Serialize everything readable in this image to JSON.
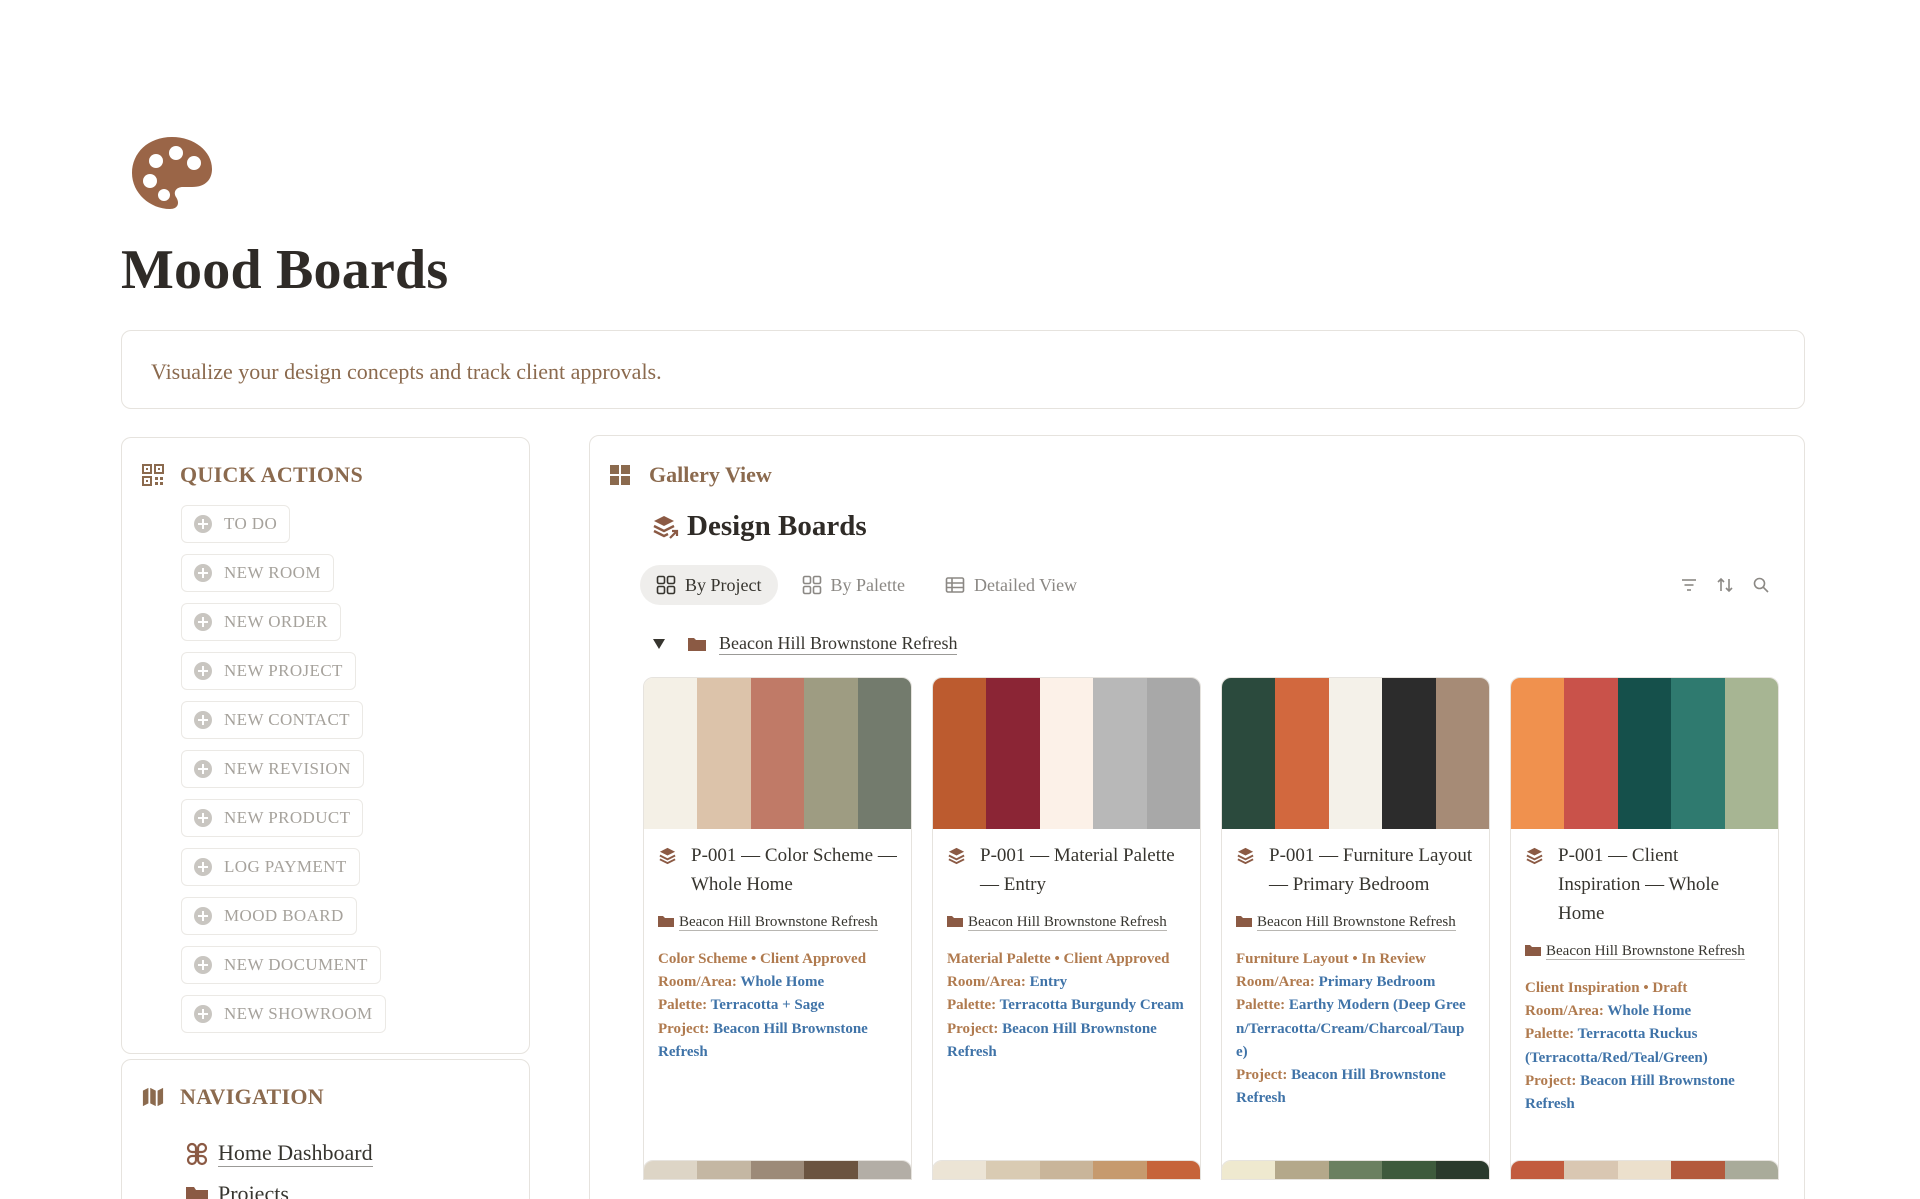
{
  "page": {
    "title": "Mood Boards",
    "icon": "palette-icon",
    "description": "Visualize your design concepts and track client approvals."
  },
  "quick_actions": {
    "title": "QUICK ACTIONS",
    "icon": "qr-grid-icon",
    "items": [
      {
        "label": "TO DO"
      },
      {
        "label": "NEW ROOM"
      },
      {
        "label": "NEW ORDER"
      },
      {
        "label": "NEW PROJECT"
      },
      {
        "label": "NEW CONTACT"
      },
      {
        "label": "NEW REVISION"
      },
      {
        "label": "NEW PRODUCT"
      },
      {
        "label": "LOG PAYMENT"
      },
      {
        "label": "MOOD BOARD"
      },
      {
        "label": "NEW DOCUMENT"
      },
      {
        "label": "NEW SHOWROOM"
      }
    ]
  },
  "navigation": {
    "title": "NAVIGATION",
    "icon": "map-icon",
    "items": [
      {
        "label": "Home Dashboard",
        "icon": "command-icon"
      },
      {
        "label": "Projects",
        "icon": "folder-icon"
      }
    ]
  },
  "gallery": {
    "header": "Gallery View",
    "icon": "grid-icon",
    "database_title": "Design Boards",
    "database_icon": "stack-icon",
    "tabs": [
      {
        "label": "By Project",
        "active": true
      },
      {
        "label": "By Palette",
        "active": false
      },
      {
        "label": "Detailed View",
        "active": false
      }
    ],
    "tools": [
      "filter-icon",
      "sort-icon",
      "search-icon"
    ],
    "group_label": "Beacon Hill Brownstone Refresh",
    "field_labels": {
      "room": "Room/Area:",
      "palette": "Palette:",
      "project": "Project:"
    },
    "cards": [
      {
        "title": "P-001 — Color Scheme — Whole Home",
        "project_tag": "Beacon Hill Brownstone Refresh",
        "type_status": "Color Scheme • Client Approved",
        "room": "Whole Home",
        "palette": "Terracotta + Sage",
        "project": "Beacon Hill Brownstone Refresh",
        "colors": [
          "#f4f0e6",
          "#dcc3aa",
          "#c07a67",
          "#9e9c82",
          "#737b6d"
        ]
      },
      {
        "title": "P-001 — Material Palette — Entry",
        "project_tag": "Beacon Hill Brownstone Refresh",
        "type_status": "Material Palette • Client Approved",
        "room": "Entry",
        "palette": "Terracotta Burgundy Cream",
        "project": "Beacon Hill Brownstone Refresh",
        "colors": [
          "#bc5b2f",
          "#8b2535",
          "#fcf1e8",
          "#b8b8b8",
          "#a8a8a8"
        ]
      },
      {
        "title": "P-001 — Furniture Layout — Primary Bedroom",
        "project_tag": "Beacon Hill Brownstone Refresh",
        "type_status": "Furniture Layout • In Review",
        "room": "Primary Bedroom",
        "palette": "Earthy Modern (Deep Green/Terracotta/Cream/Charcoal/Taupe)",
        "project": "Beacon Hill Brownstone Refresh",
        "colors": [
          "#2b4a3d",
          "#d2683e",
          "#f4f1e9",
          "#2c2c2c",
          "#a68b76"
        ]
      },
      {
        "title": "P-001 — Client Inspiration — Whole Home",
        "project_tag": "Beacon Hill Brownstone Refresh",
        "type_status": "Client Inspiration • Draft",
        "room": "Whole Home",
        "palette": "Terracotta Ruckus (Terracotta/Red/Teal/Green)",
        "project": "Beacon Hill Brownstone Refresh",
        "colors": [
          "#f0914e",
          "#c9524a",
          "#15504b",
          "#2f7a6f",
          "#a7b593"
        ]
      }
    ],
    "next_row_colors": [
      [
        "#ddd5c6",
        "#c4b7a3",
        "#9c8a78",
        "#6b5440",
        "#b3aea6"
      ],
      [
        "#ece4d5",
        "#d9cbb3",
        "#c9b59a",
        "#c69a6e",
        "#c6643a"
      ],
      [
        "#efe9cf",
        "#b4a88a",
        "#6b8060",
        "#3e5a3c",
        "#2b3a2c"
      ],
      [
        "#c25c3e",
        "#d9c7b2",
        "#ece0cc",
        "#b35a3c",
        "#a9ab9a"
      ]
    ]
  }
}
